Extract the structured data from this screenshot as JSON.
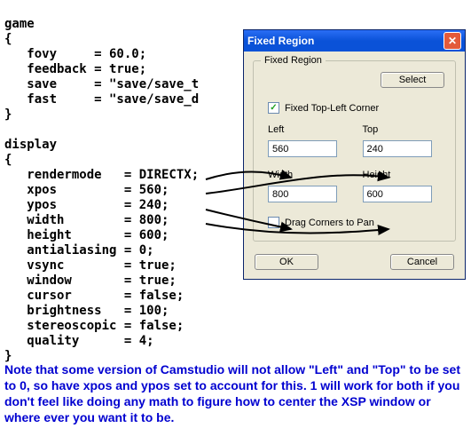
{
  "code_text": "game\n{\n   fovy     = 60.0;\n   feedback = true;\n   save     = \"save/save_t\n   fast     = \"save/save_d\n}\n\ndisplay\n{\n   rendermode   = DIRECTX;\n   xpos         = 560;\n   ypos         = 240;\n   width        = 800;\n   height       = 600;\n   antialiasing = 0;\n   vsync        = true;\n   window       = true;\n   cursor       = false;\n   brightness   = 100;\n   stereoscopic = false;\n   quality      = 4;\n}",
  "dialog": {
    "title": "Fixed Region",
    "group_title": "Fixed Region",
    "select_btn": "Select",
    "checkbox_label": "Fixed Top-Left Corner",
    "checkbox_checked": "✓",
    "left_label": "Left",
    "top_label": "Top",
    "width_label": "Width",
    "height_label": "Height",
    "left_val": "560",
    "top_val": "240",
    "width_val": "800",
    "height_val": "600",
    "drag_label": "Drag Corners to Pan",
    "ok": "OK",
    "cancel": "Cancel"
  },
  "note_text": "Note that some version of Camstudio will not allow \"Left\" and \"Top\" to be set to 0, so have xpos and ypos set to account for this. 1 will work for both if you don't feel like doing any math to figure how to center the XSP window or where ever you want it to be."
}
